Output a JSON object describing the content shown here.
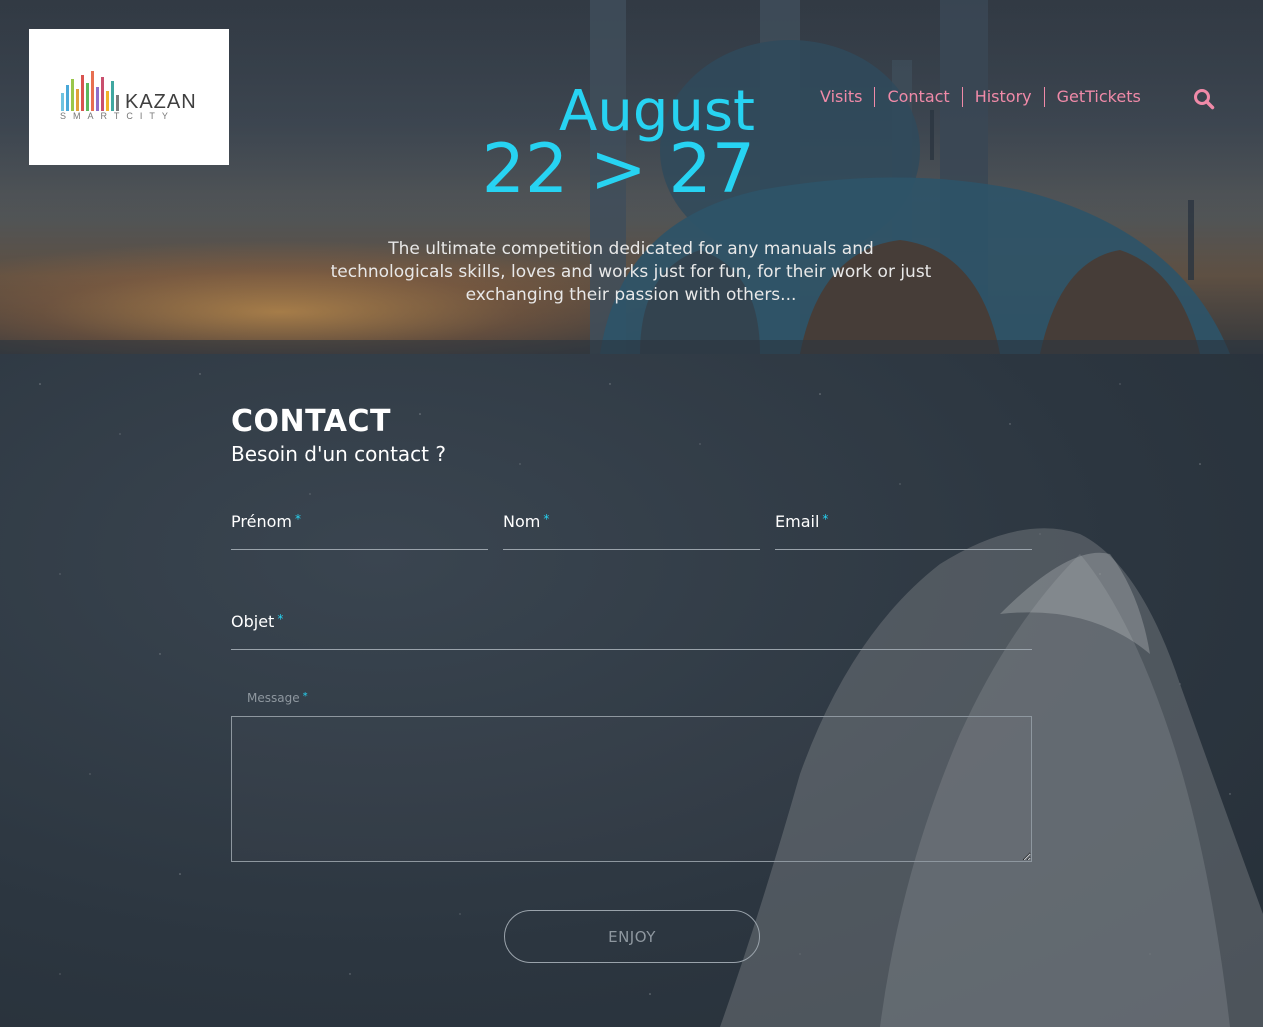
{
  "brand": {
    "name": "KAZAN",
    "tagline": "SMARTCITY"
  },
  "event": {
    "month": "August",
    "range": "22 > 27",
    "description": "The ultimate competition dedicated for any manuals and technologicals skills, loves and works just for fun, for their work or just exchanging their passion with others..."
  },
  "nav": {
    "items": [
      {
        "label": "Visits"
      },
      {
        "label": "Contact"
      },
      {
        "label": "History"
      },
      {
        "label": "GetTickets"
      }
    ],
    "search_icon": "search-icon"
  },
  "contact": {
    "title": "CONTACT",
    "subtitle": "Besoin d'un contact ?",
    "fields": {
      "firstname": {
        "label": "Prénom",
        "required": "*",
        "value": ""
      },
      "lastname": {
        "label": "Nom",
        "required": "*",
        "value": ""
      },
      "email": {
        "label": "Email",
        "required": "*",
        "value": ""
      },
      "subject": {
        "label": "Objet",
        "required": "*",
        "value": ""
      },
      "message": {
        "label": "Message",
        "required": "*",
        "value": ""
      }
    },
    "submit_label": "ENJOY"
  },
  "colors": {
    "accent": "#27d3f2",
    "nav": "#f08aa8",
    "background": "#2c3640"
  }
}
